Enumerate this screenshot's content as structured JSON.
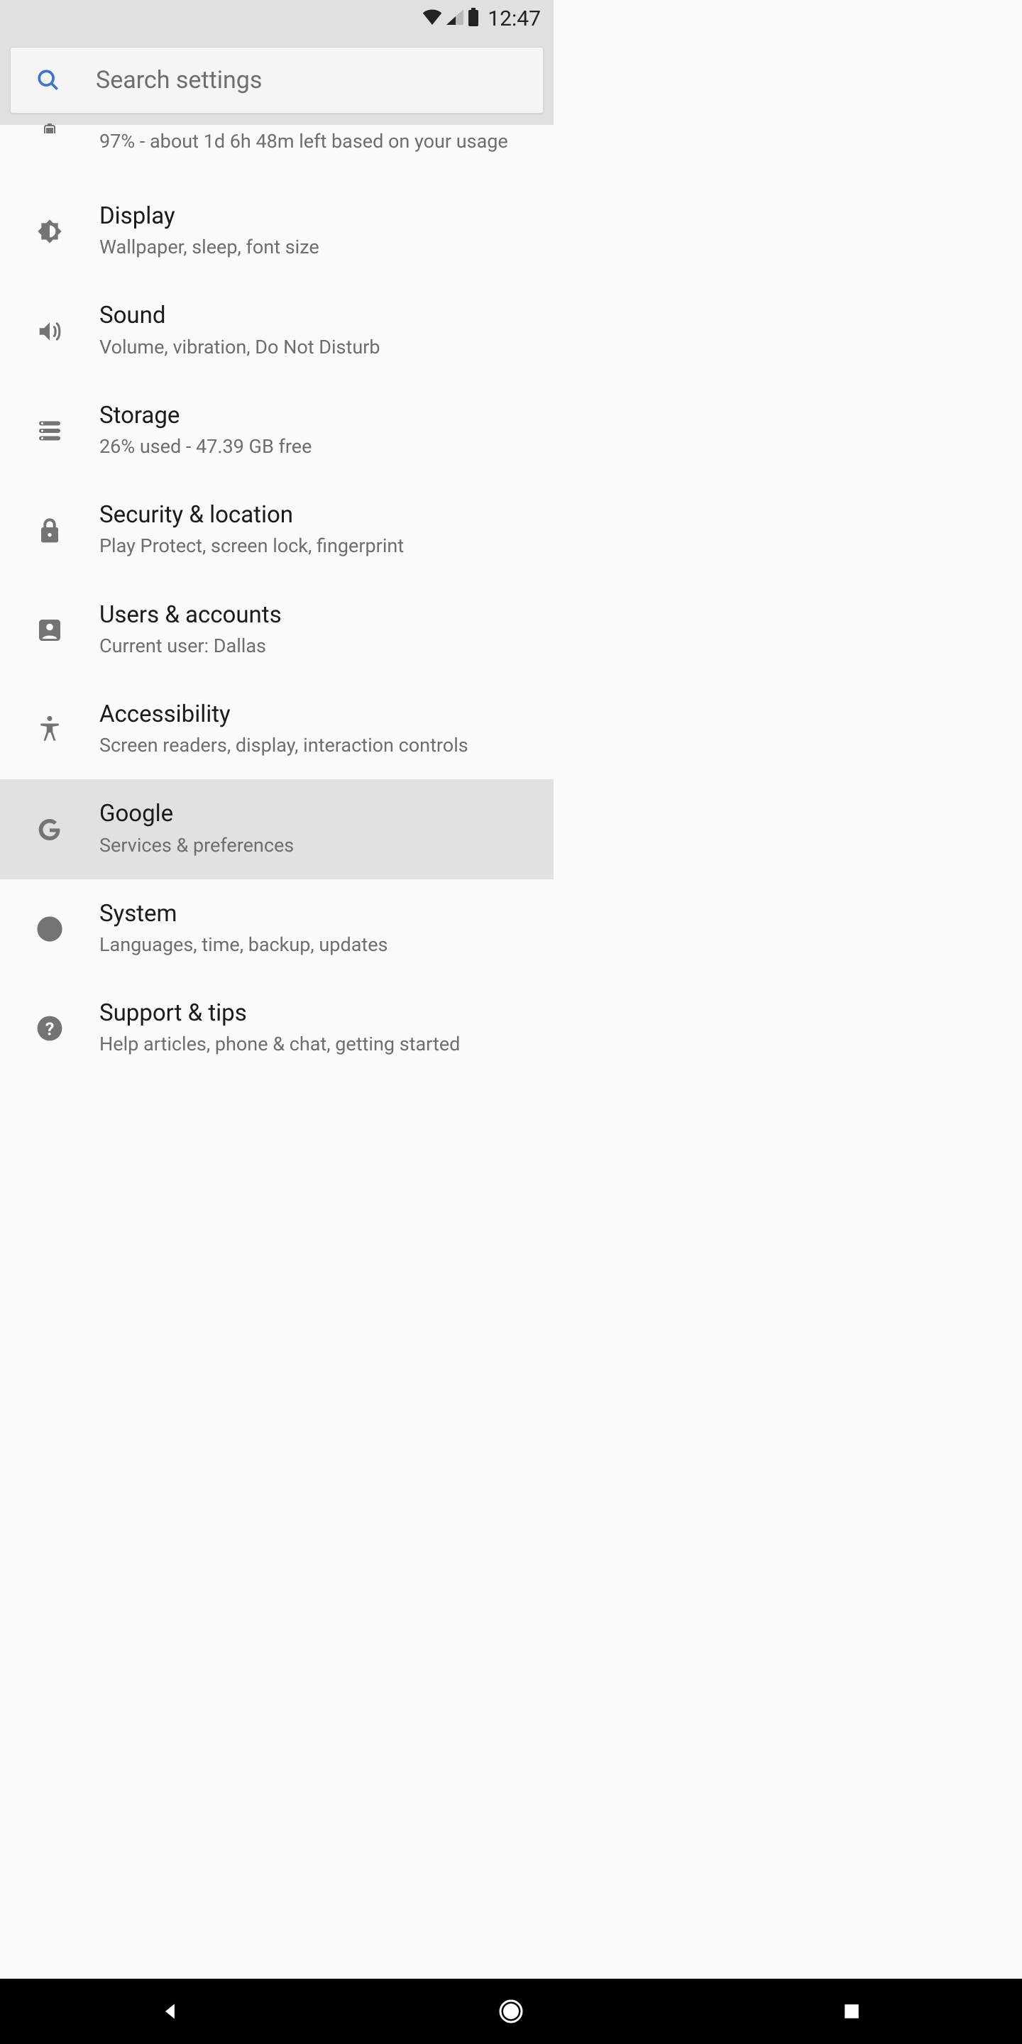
{
  "status": {
    "time": "12:47"
  },
  "search": {
    "placeholder": "Search settings"
  },
  "settings": [
    {
      "key": "battery",
      "title": "",
      "subtitle": "97% - about 1d 6h 48m left based on your usage",
      "icon": "battery",
      "selected": false
    },
    {
      "key": "display",
      "title": "Display",
      "subtitle": "Wallpaper, sleep, font size",
      "icon": "brightness",
      "selected": false
    },
    {
      "key": "sound",
      "title": "Sound",
      "subtitle": "Volume, vibration, Do Not Disturb",
      "icon": "volume",
      "selected": false
    },
    {
      "key": "storage",
      "title": "Storage",
      "subtitle": "26% used - 47.39 GB free",
      "icon": "storage",
      "selected": false
    },
    {
      "key": "security",
      "title": "Security & location",
      "subtitle": "Play Protect, screen lock, fingerprint",
      "icon": "lock",
      "selected": false
    },
    {
      "key": "users",
      "title": "Users & accounts",
      "subtitle": "Current user: Dallas",
      "icon": "account",
      "selected": false
    },
    {
      "key": "accessibility",
      "title": "Accessibility",
      "subtitle": "Screen readers, display, interaction controls",
      "icon": "accessibility",
      "selected": false
    },
    {
      "key": "google",
      "title": "Google",
      "subtitle": "Services & preferences",
      "icon": "google",
      "selected": true
    },
    {
      "key": "system",
      "title": "System",
      "subtitle": "Languages, time, backup, updates",
      "icon": "info",
      "selected": false
    },
    {
      "key": "support",
      "title": "Support & tips",
      "subtitle": "Help articles, phone & chat, getting started",
      "icon": "help",
      "selected": false
    }
  ]
}
